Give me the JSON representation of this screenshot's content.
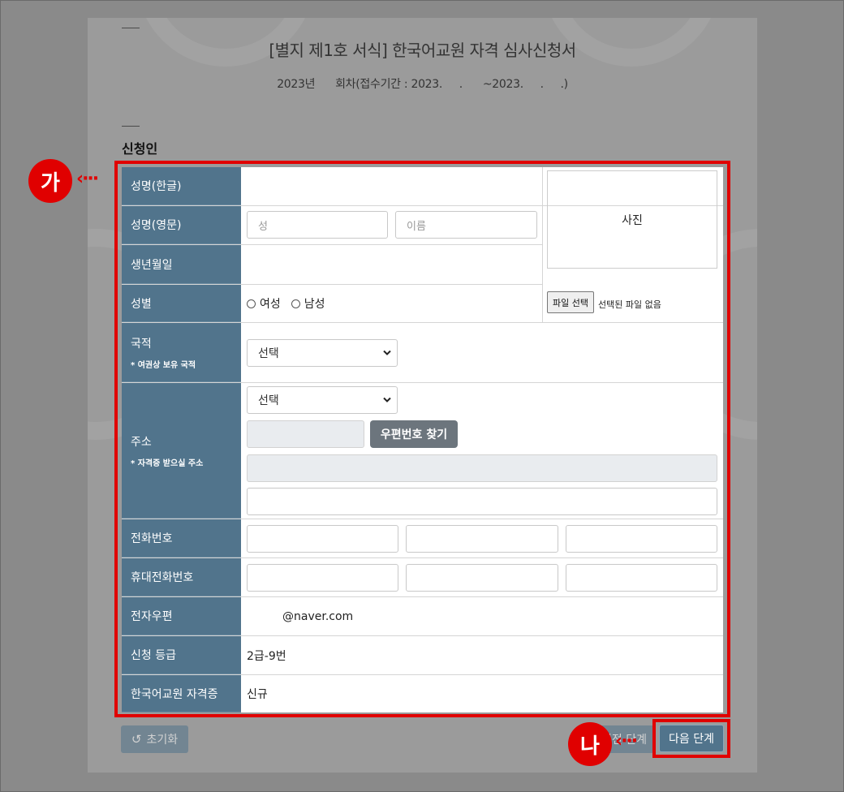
{
  "header": {
    "title": "[별지 제1호 서식] 한국어교원 자격 심사신청서",
    "subtitle": "2023년      회차(접수기간 : 2023.     .      ~2023.     .     .)"
  },
  "section": {
    "label": "신청인"
  },
  "form": {
    "name_kr": {
      "label": "성명(한글)"
    },
    "name_en": {
      "label": "성명(영문)",
      "last_placeholder": "성",
      "first_placeholder": "이름"
    },
    "birth": {
      "label": "생년월일"
    },
    "gender": {
      "label": "성별",
      "options": [
        "여성",
        "남성"
      ]
    },
    "photo": {
      "label": "사진",
      "file_button": "파일 선택",
      "file_status": "선택된 파일 없음"
    },
    "nationality": {
      "label": "국적",
      "note": "* 여권상 보유 국적",
      "selected": "선택"
    },
    "address": {
      "label": "주소",
      "note": "* 자격증 받으실 주소",
      "selected": "선택",
      "zip_button": "우편번호 찾기"
    },
    "phone": {
      "label": "전화번호"
    },
    "mobile": {
      "label": "휴대전화번호"
    },
    "email": {
      "label": "전자우편",
      "value": "@naver.com"
    },
    "grade": {
      "label": "신청 등급",
      "value": "2급-9번"
    },
    "certificate": {
      "label": "한국어교원 자격증",
      "value": "신규"
    }
  },
  "buttons": {
    "reset": "초기화",
    "prev": "이전 단계",
    "next": "다음 단계"
  },
  "markers": {
    "a": "가",
    "b": "나"
  },
  "colors": {
    "label_bg": "#51748c",
    "highlight": "#e00000",
    "zip_button": "#6c757d"
  }
}
